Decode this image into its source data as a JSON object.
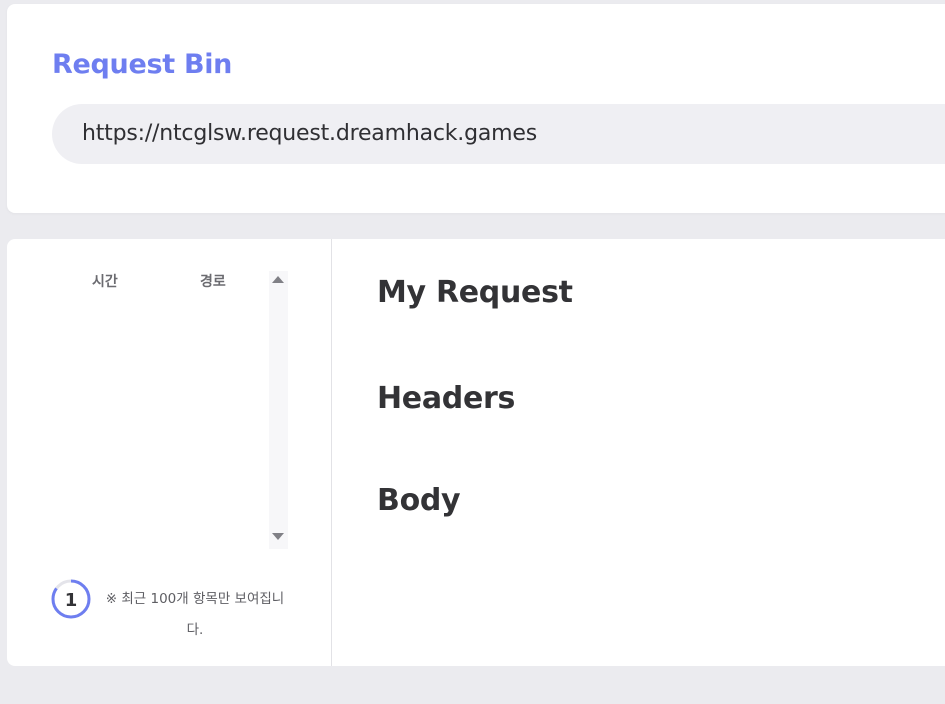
{
  "header": {
    "title": "Request Bin",
    "url": "https://ntcglsw.request.dreamhack.games"
  },
  "request_list": {
    "columns": [
      "시간",
      "경로"
    ],
    "rows": [],
    "count": "1",
    "notice": "※ 최근 100개 항목만 보여집니다."
  },
  "detail": {
    "sections": [
      "My Request",
      "Headers",
      "Body"
    ]
  },
  "colors": {
    "accent": "#6e7ef0",
    "background": "#ebebef"
  },
  "icons": {
    "scroll_up": "triangle-up-icon",
    "scroll_down": "triangle-down-icon"
  }
}
